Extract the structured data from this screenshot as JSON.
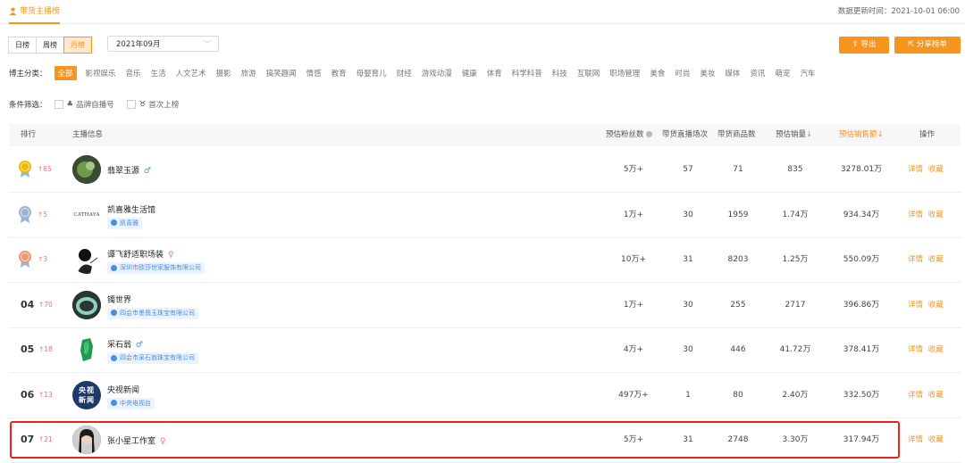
{
  "header": {
    "active_tab": "带货主播榜",
    "update_time": "数据更新时间：2021-10-01 06:00"
  },
  "period": {
    "day": "日榜",
    "week": "周榜",
    "month": "月榜",
    "selected_month": "2021年09月"
  },
  "actions": {
    "export": "导出",
    "share": "分享榜单"
  },
  "category": {
    "label": "博主分类：",
    "items": [
      "全部",
      "影视娱乐",
      "音乐",
      "生活",
      "人文艺术",
      "摄影",
      "旅游",
      "搞笑趣闻",
      "情感",
      "教育",
      "母婴育儿",
      "财经",
      "游戏动漫",
      "健康",
      "体育",
      "科学科普",
      "科技",
      "互联网",
      "职场管理",
      "美食",
      "时尚",
      "美妆",
      "媒体",
      "资讯",
      "萌宠",
      "汽车"
    ]
  },
  "filter": {
    "label": "条件筛选：",
    "brand": "品牌自播号",
    "first": "首次上榜"
  },
  "table": {
    "headers": {
      "rank": "排行",
      "info": "主播信息",
      "fans": "预估粉丝数",
      "live": "带货直播场次",
      "goods": "带货商品数",
      "volume": "预估销量",
      "sales": "预估销售额",
      "op": "操作"
    },
    "rows": [
      {
        "rank": "",
        "change": "↑65",
        "name": "翡翠玉源",
        "gender": "♂",
        "tag": "",
        "fans": "5万+",
        "live": "57",
        "goods": "71",
        "volume": "835",
        "sales": "3278.01万"
      },
      {
        "rank": "",
        "change": "↑5",
        "name": "凯喜雅生活馆",
        "gender": "",
        "tag": "凯喜雅",
        "fans": "1万+",
        "live": "30",
        "goods": "1959",
        "volume": "1.74万",
        "sales": "934.34万"
      },
      {
        "rank": "",
        "change": "↑3",
        "name": "谭飞舒适职场装",
        "gender": "♀",
        "tag": "深圳市欧莎世家服饰有限公司",
        "fans": "10万+",
        "live": "31",
        "goods": "8203",
        "volume": "1.25万",
        "sales": "550.09万"
      },
      {
        "rank": "04",
        "change": "↑70",
        "name": "镯世界",
        "gender": "",
        "tag": "四会市墨翡玉珠宝有限公司",
        "fans": "1万+",
        "live": "30",
        "goods": "255",
        "volume": "2717",
        "sales": "396.86万"
      },
      {
        "rank": "05",
        "change": "↑18",
        "name": "采石翁",
        "gender": "♂",
        "tag": "四会市采石翁珠宝有限公司",
        "fans": "4万+",
        "live": "30",
        "goods": "446",
        "volume": "41.72万",
        "sales": "378.41万"
      },
      {
        "rank": "06",
        "change": "↑13",
        "name": "央视新闻",
        "gender": "",
        "tag": "中央电视台",
        "fans": "497万+",
        "live": "1",
        "goods": "80",
        "volume": "2.40万",
        "sales": "332.50万"
      },
      {
        "rank": "07",
        "change": "↑21",
        "name": "张小星工作室",
        "gender": "♀",
        "tag": "",
        "fans": "5万+",
        "live": "31",
        "goods": "2748",
        "volume": "3.30万",
        "sales": "317.94万"
      }
    ],
    "op_detail": "详情",
    "op_fav": "收藏"
  },
  "logo_text": {
    "cathaya": "CATHAYA",
    "cctv": "央视新闻"
  },
  "colors": {
    "accent": "#f7941d",
    "rise": "#f56c6c",
    "highlight": "#e8241a",
    "tag_bg": "#eaf3ff",
    "tag_text": "#4a8de0"
  }
}
